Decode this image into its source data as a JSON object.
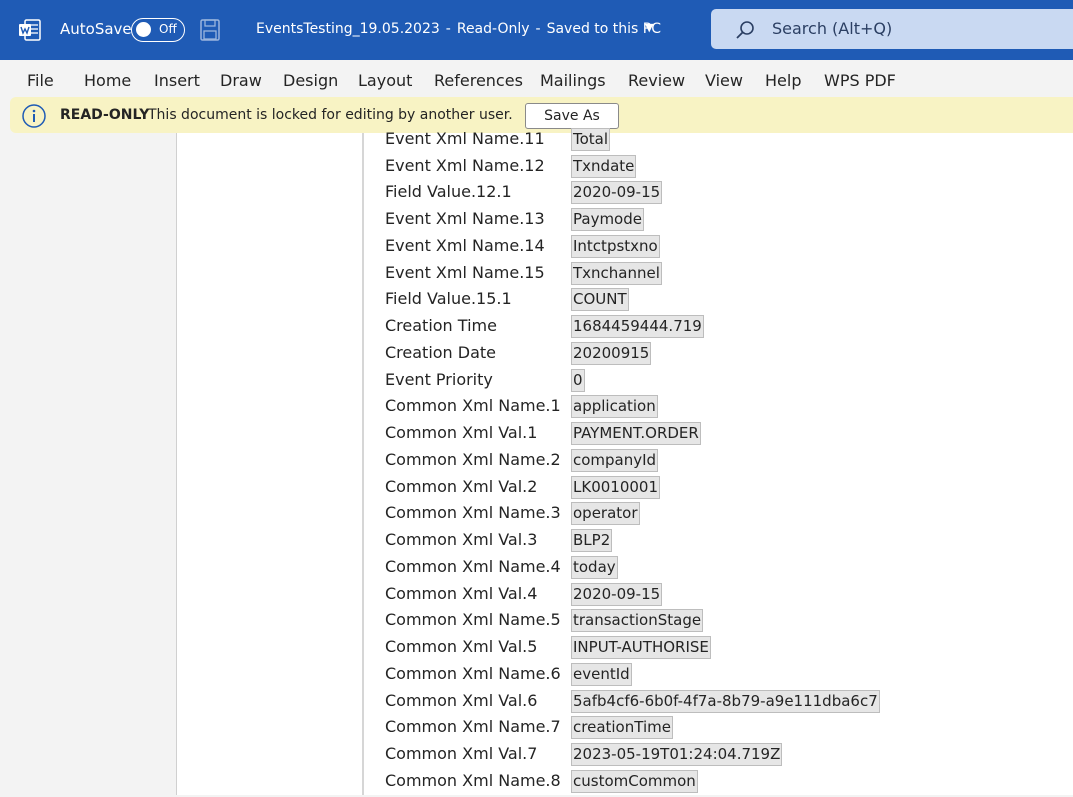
{
  "titlebar": {
    "autosave_label": "AutoSave",
    "autosave_state": "Off",
    "doc_name": "EventsTesting_19.05.2023",
    "read_only": "Read-Only",
    "save_status": "Saved to this PC",
    "search_placeholder": "Search (Alt+Q)",
    "bar_color": "#1f5bb5"
  },
  "menu": [
    "File",
    "Home",
    "Insert",
    "Draw",
    "Design",
    "Layout",
    "References",
    "Mailings",
    "Review",
    "View",
    "Help",
    "WPS PDF"
  ],
  "infobar": {
    "title": "READ-ONLY",
    "message": "This document is locked for editing by another user.",
    "button": "Save As",
    "color": "#f8f3c4"
  },
  "rows": [
    {
      "label": "Event Xml Name.11",
      "value": "Total"
    },
    {
      "label": "Event Xml Name.12",
      "value": "Txndate"
    },
    {
      "label": "Field Value.12.1",
      "value": "2020-09-15"
    },
    {
      "label": "Event Xml Name.13",
      "value": "Paymode"
    },
    {
      "label": "Event Xml Name.14",
      "value": "Intctpstxno"
    },
    {
      "label": "Event Xml Name.15",
      "value": "Txnchannel"
    },
    {
      "label": "Field Value.15.1",
      "value": "COUNT"
    },
    {
      "label": "Creation Time",
      "value": "1684459444.719"
    },
    {
      "label": "Creation Date",
      "value": "20200915"
    },
    {
      "label": "Event Priority",
      "value": "0"
    },
    {
      "label": "Common Xml Name.1",
      "value": "application"
    },
    {
      "label": "Common Xml Val.1",
      "value": "PAYMENT.ORDER"
    },
    {
      "label": "Common Xml Name.2",
      "value": "companyId"
    },
    {
      "label": "Common Xml Val.2",
      "value": "LK0010001"
    },
    {
      "label": "Common Xml Name.3",
      "value": "operator"
    },
    {
      "label": "Common Xml Val.3",
      "value": "BLP2"
    },
    {
      "label": "Common Xml Name.4",
      "value": "today"
    },
    {
      "label": "Common Xml Val.4",
      "value": "2020-09-15"
    },
    {
      "label": "Common Xml Name.5",
      "value": "transactionStage"
    },
    {
      "label": "Common Xml Val.5",
      "value": "INPUT-AUTHORISE"
    },
    {
      "label": "Common Xml Name.6",
      "value": "eventId"
    },
    {
      "label": "Common Xml Val.6",
      "value": "5afb4cf6-6b0f-4f7a-8b79-a9e111dba6c7"
    },
    {
      "label": "Common Xml Name.7",
      "value": "creationTime"
    },
    {
      "label": "Common Xml Val.7",
      "value": "2023-05-19T01:24:04.719Z"
    },
    {
      "label": "Common Xml Name.8",
      "value": "customCommon"
    }
  ]
}
